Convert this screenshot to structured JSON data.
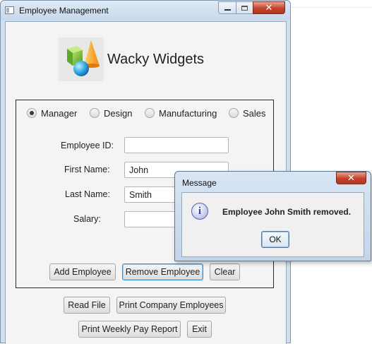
{
  "window": {
    "title": "Employee Management"
  },
  "brand": {
    "name": "Wacky Widgets",
    "logo_icon": "shapes-logo-icon"
  },
  "departments": [
    {
      "label": "Manager",
      "selected": true
    },
    {
      "label": "Design",
      "selected": false
    },
    {
      "label": "Manufacturing",
      "selected": false
    },
    {
      "label": "Sales",
      "selected": false
    }
  ],
  "form": {
    "employee_id": {
      "label": "Employee ID:",
      "value": ""
    },
    "first_name": {
      "label": "First Name:",
      "value": "John"
    },
    "last_name": {
      "label": "Last Name:",
      "value": "Smith"
    },
    "salary": {
      "label": "Salary:",
      "value": ""
    }
  },
  "buttons": {
    "add": "Add Employee",
    "remove": "Remove Employee",
    "clear": "Clear",
    "read_file": "Read File",
    "print_company": "Print Company Employees",
    "print_weekly": "Print Weekly Pay Report",
    "exit": "Exit"
  },
  "dialog": {
    "title": "Message",
    "message": "Employee John Smith removed.",
    "ok": "OK",
    "icon": "info-icon"
  },
  "colors": {
    "titlebar": "#c6d8ec",
    "close_button": "#c4412b",
    "focus_ring": "#3a8fd6"
  }
}
